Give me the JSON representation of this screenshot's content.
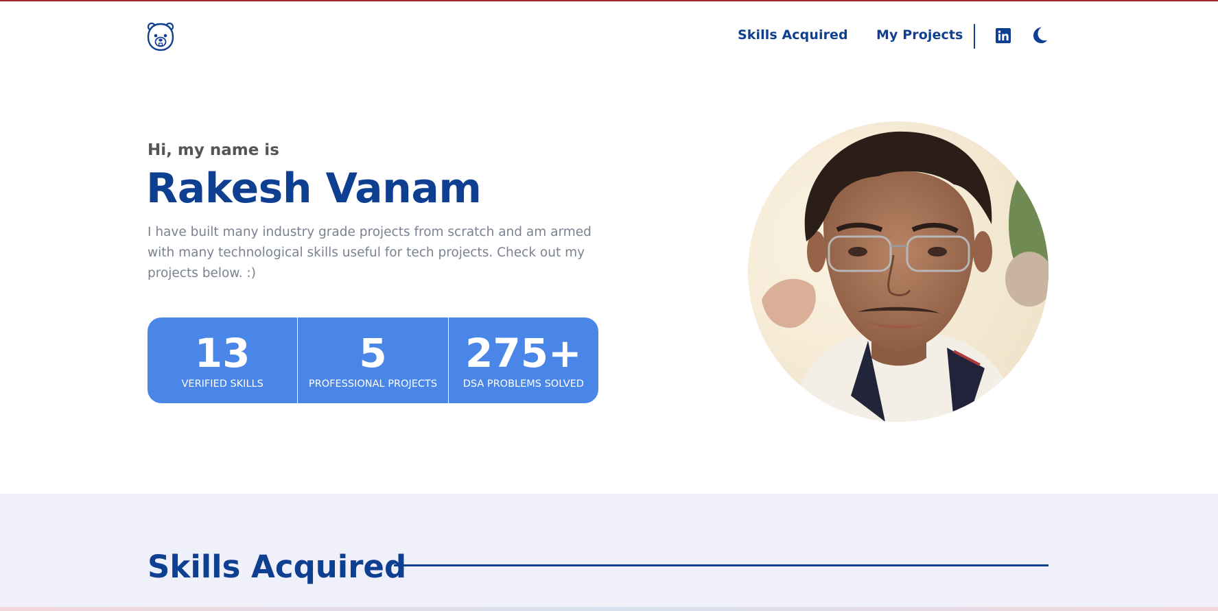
{
  "nav": {
    "skills_label": "Skills Acquired",
    "projects_label": "My Projects",
    "linkedin_icon": "linkedin-icon",
    "theme_icon": "moon-icon"
  },
  "hero": {
    "greeting": "Hi, my name is",
    "name": "Rakesh Vanam",
    "description": "I have built many industry grade projects from scratch and am armed with many technological skills useful for tech projects. Check out my projects below. :)"
  },
  "stats": [
    {
      "number": "13",
      "label": "VERIFIED SKILLS"
    },
    {
      "number": "5",
      "label": "PROFESSIONAL PROJECTS"
    },
    {
      "number": "275+",
      "label": "DSA PROBLEMS SOLVED"
    }
  ],
  "skills_section": {
    "title": "Skills Acquired"
  },
  "colors": {
    "primary": "#0f3f91",
    "stats_bg": "#4a86e8",
    "section_bg": "#eff0f9",
    "top_accent": "#a4252c"
  }
}
